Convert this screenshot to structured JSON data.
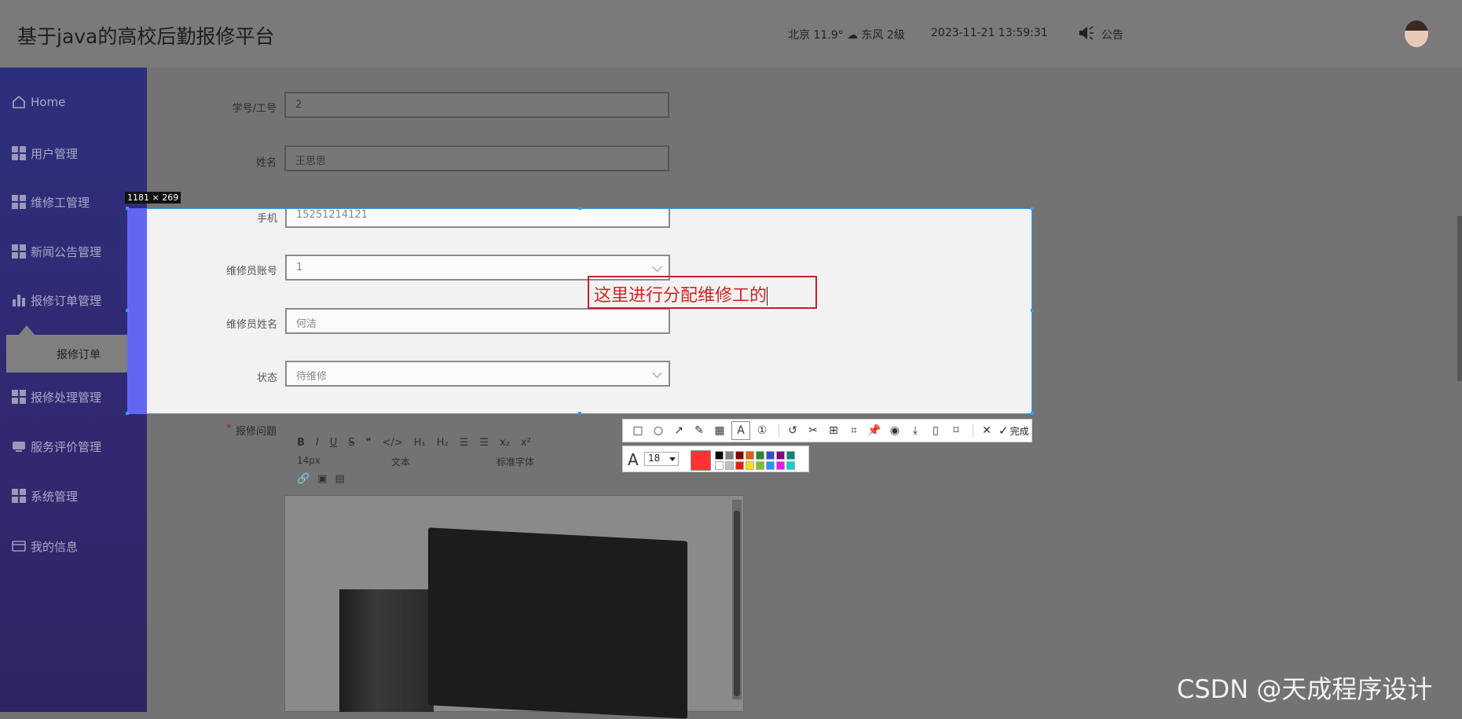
{
  "header": {
    "app_title": "基于java的高校后勤报修平台",
    "weather": "北京  11.9°  ☁  东风  2级",
    "datetime": "2023-11-21 13:59:31",
    "notice_label": "公告"
  },
  "sidebar": {
    "items": [
      {
        "label": "Home",
        "icon": "home-icon"
      },
      {
        "label": "用户管理",
        "icon": "grid-icon"
      },
      {
        "label": "维修工管理",
        "icon": "grid-icon"
      },
      {
        "label": "新闻公告管理",
        "icon": "grid-icon"
      },
      {
        "label": "报修订单管理",
        "icon": "bar-chart-icon"
      },
      {
        "label": "报修处理管理",
        "icon": "grid-icon"
      },
      {
        "label": "服务评价管理",
        "icon": "monitor-icon"
      },
      {
        "label": "系统管理",
        "icon": "grid-icon"
      },
      {
        "label": "我的信息",
        "icon": "card-icon"
      }
    ],
    "submenu_item": "报修订单"
  },
  "form": {
    "fields": [
      {
        "label": "学号/工号",
        "value": "2"
      },
      {
        "label": "姓名",
        "value": "王思思"
      },
      {
        "label": "手机",
        "value": "15251214121"
      },
      {
        "label": "维修员账号",
        "value": "1"
      },
      {
        "label": "维修员姓名",
        "value": "何洁"
      },
      {
        "label": "状态",
        "value": "待维修"
      }
    ],
    "required_star": "*",
    "problem_label": "报修问题"
  },
  "editor": {
    "row1": [
      "B",
      "I",
      "U",
      "S",
      "❞",
      "</>",
      "H₁",
      "H₂",
      "☰",
      "☰",
      "x₂",
      "x²"
    ],
    "font_size": "14px",
    "text_type": "文本",
    "font_family": "标准字体"
  },
  "capture": {
    "dimensions": "1181 × 269",
    "annotation_text": "这里进行分配维修工的",
    "done_label": "完成",
    "font_size_value": "18",
    "current_color": "#ff3333"
  },
  "watermark": "CSDN @天成程序设计"
}
